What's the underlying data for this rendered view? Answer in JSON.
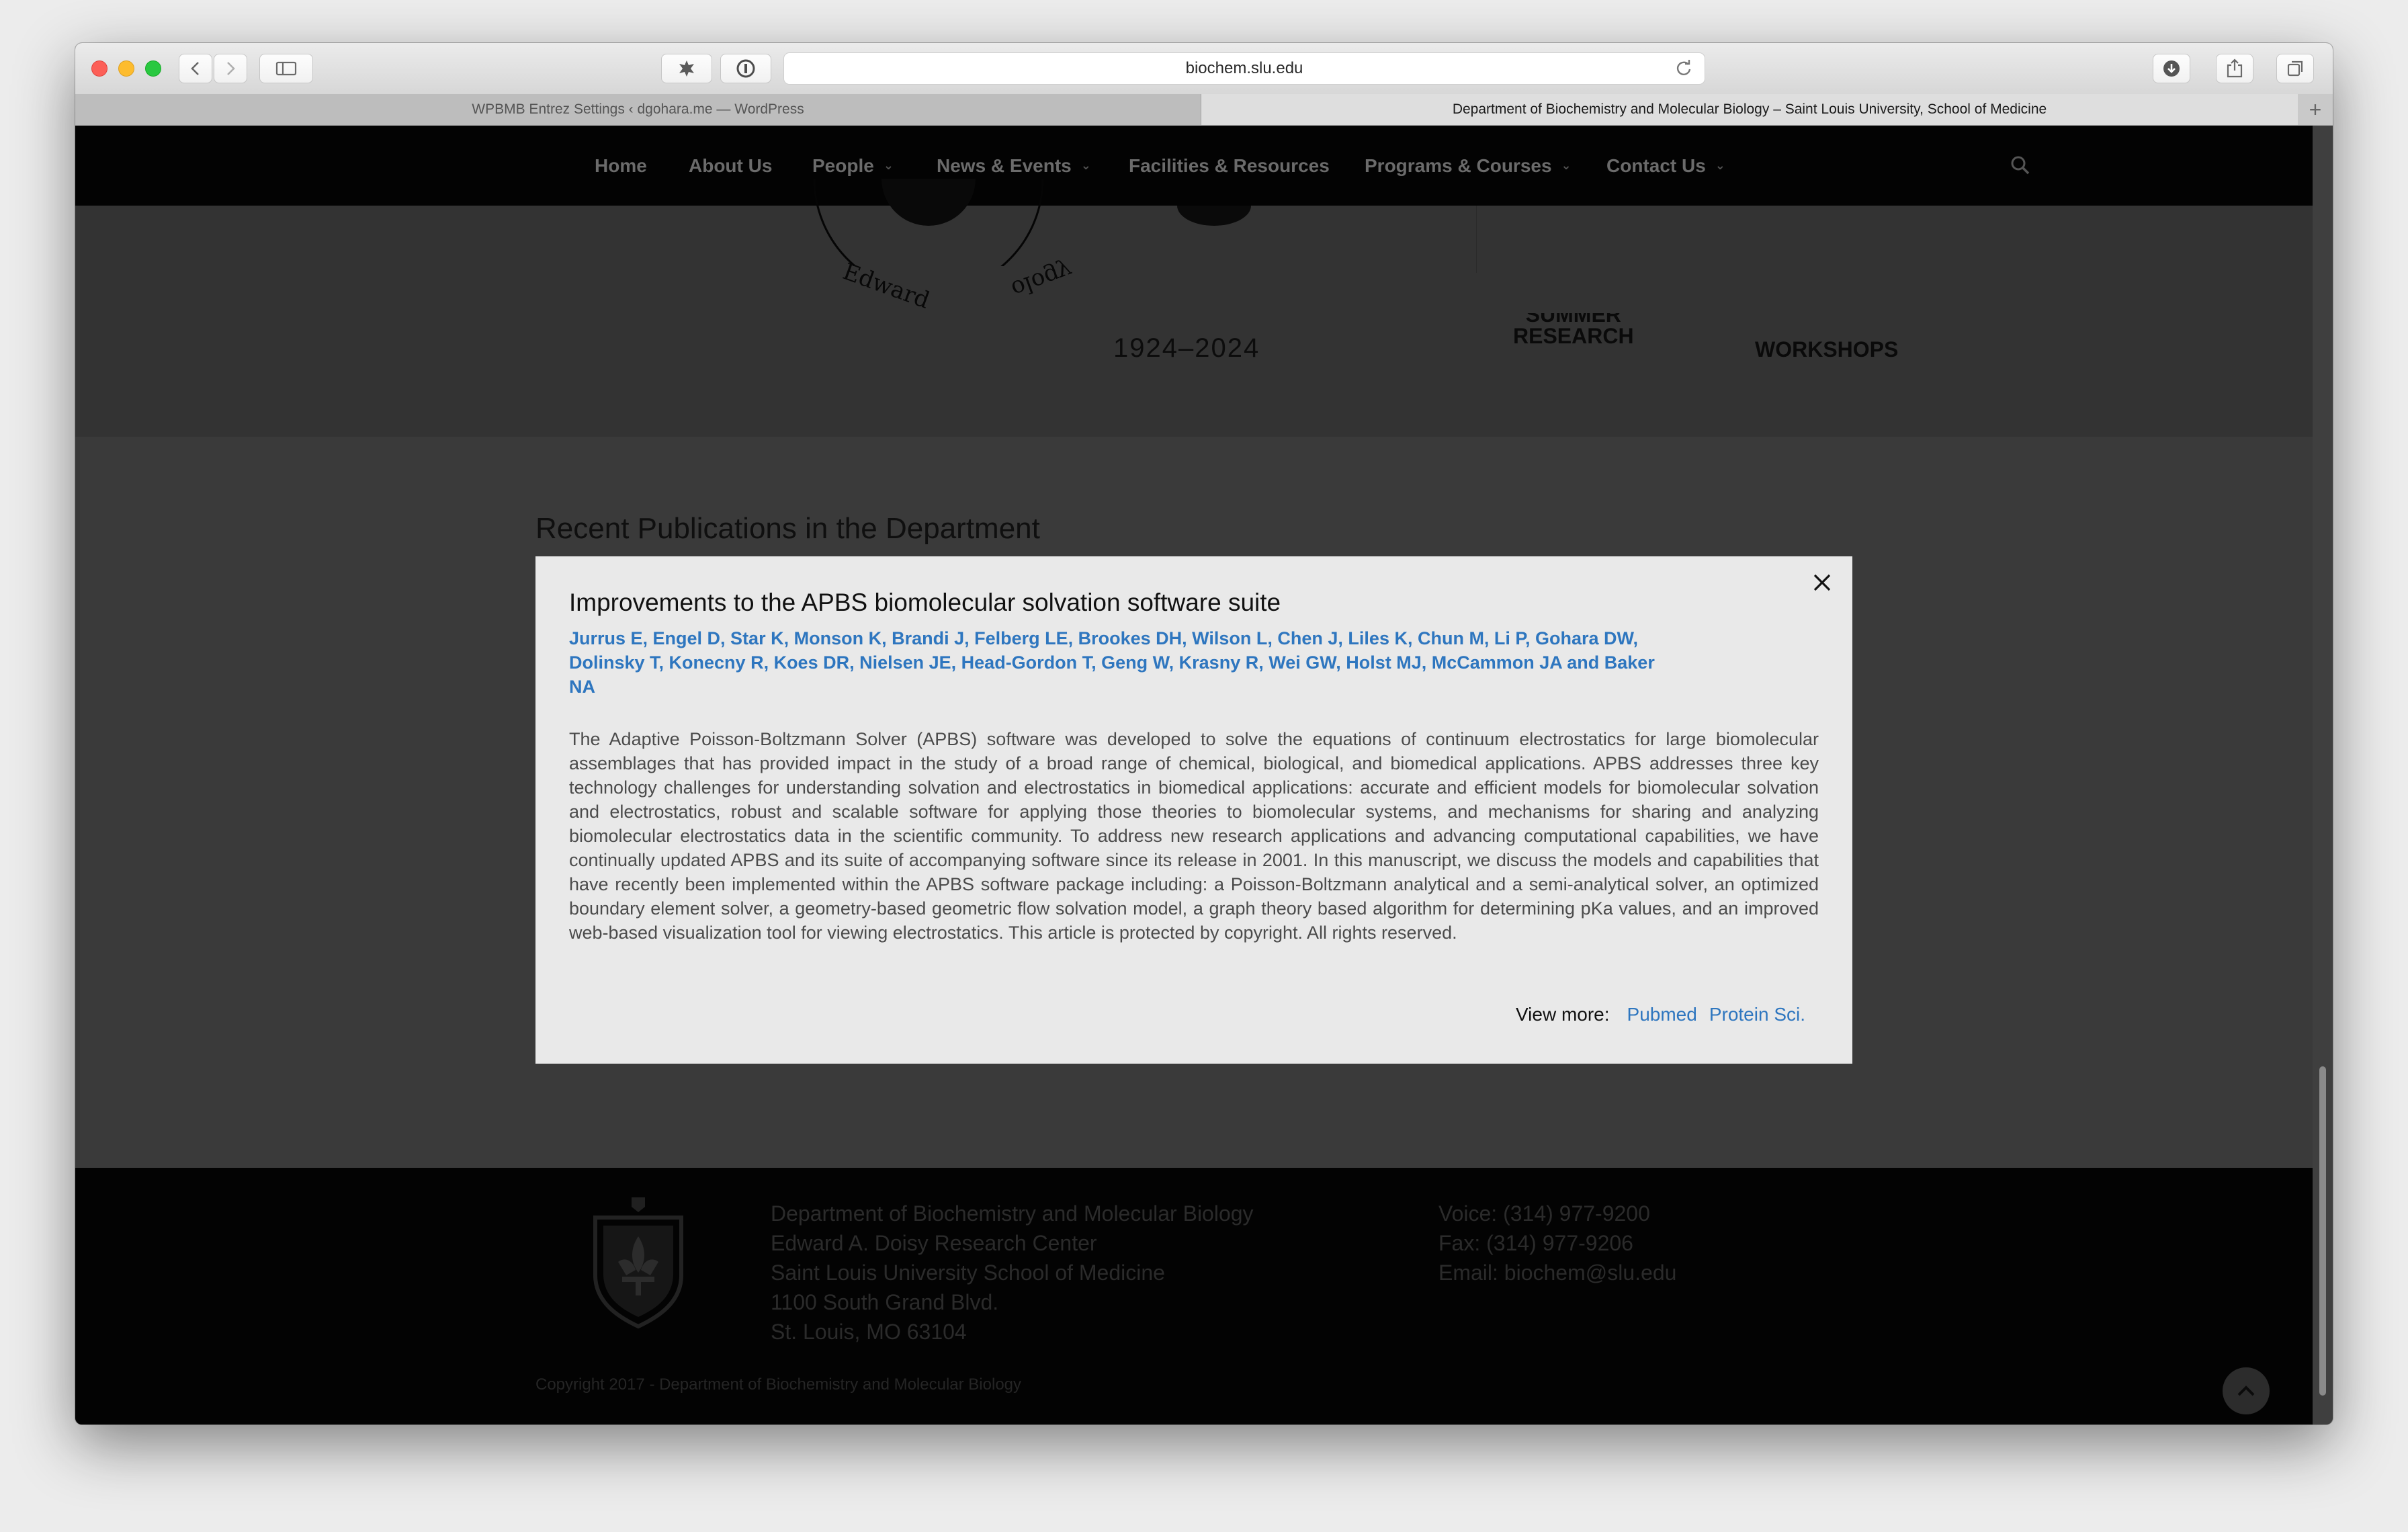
{
  "browser": {
    "url": "biochem.slu.edu",
    "tabs": [
      {
        "label": "WPBMB Entrez Settings ‹ dgohara.me — WordPress",
        "active": false
      },
      {
        "label": "Department of Biochemistry and Molecular Biology – Saint Louis University, School of Medicine",
        "active": true
      }
    ]
  },
  "nav": {
    "items": [
      {
        "label": "Home",
        "dropdown": false
      },
      {
        "label": "About Us",
        "dropdown": false
      },
      {
        "label": "People",
        "dropdown": true
      },
      {
        "label": "News & Events",
        "dropdown": true
      },
      {
        "label": "Facilities & Resources",
        "dropdown": false
      },
      {
        "label": "Programs & Courses",
        "dropdown": true
      },
      {
        "label": "Contact Us",
        "dropdown": true
      }
    ]
  },
  "banner": {
    "seal_left": "Edward",
    "seal_right": "ology",
    "years": "1924–2024",
    "link1_line1": "SUMMER",
    "link1_line2": "RESEARCH",
    "link2": "WORKSHOPS"
  },
  "section": {
    "title": "Recent Publications in the Department"
  },
  "modal": {
    "title": "Improvements to the APBS biomolecular solvation software suite",
    "authors": "Jurrus E, Engel D, Star K, Monson K, Brandi J, Felberg LE, Brookes DH, Wilson L, Chen J, Liles K, Chun M, Li P, Gohara DW, Dolinsky T, Konecny R, Koes DR, Nielsen JE, Head-Gordon T, Geng W, Krasny R, Wei GW, Holst MJ, McCammon JA and Baker NA",
    "abstract": "The Adaptive Poisson-Boltzmann Solver (APBS) software was developed to solve the equations of continuum electrostatics for large biomolecular assemblages that has provided impact in the study of a broad range of chemical, biological, and biomedical applications. APBS addresses three key technology challenges for understanding solvation and electrostatics in biomedical applications: accurate and efficient models for biomolecular solvation and electrostatics, robust and scalable software for applying those theories to biomolecular systems, and mechanisms for sharing and analyzing biomolecular electrostatics data in the scientific community. To address new research applications and advancing computational capabilities, we have continually updated APBS and its suite of accompanying software since its release in 2001. In this manuscript, we discuss the models and capabilities that have recently been implemented within the APBS software package including: a Poisson-Boltzmann analytical and a semi-analytical solver, an optimized boundary element solver, a geometry-based geometric flow solvation model, a graph theory based algorithm for determining pKa values, and an improved web-based visualization tool for viewing electrostatics. This article is protected by copyright. All rights reserved.",
    "view_more_label": "View more:",
    "link_pubmed": "Pubmed",
    "link_journal": "Protein Sci."
  },
  "footer": {
    "address": [
      "Department of Biochemistry and Molecular Biology",
      "Edward A. Doisy Research Center",
      "Saint Louis University School of Medicine",
      "1100 South Grand Blvd.",
      "St. Louis, MO 63104"
    ],
    "voice": "Voice: (314) 977-9200",
    "fax": "Fax: (314) 977-9206",
    "email": "Email: biochem@slu.edu",
    "copyright": "Copyright 2017 - Department of Biochemistry and Molecular Biology"
  },
  "colors": {
    "accent_link": "#2e76bf",
    "navbar_bg": "#030303",
    "overlay_bg": "#3a3a3a",
    "modal_bg": "#e9e9e9"
  },
  "icons": [
    "close-icon",
    "search-icon",
    "chevron-down-icon",
    "back-icon",
    "forward-icon",
    "sidebar-icon",
    "extension-icon",
    "password-icon",
    "reload-icon",
    "download-icon",
    "share-icon",
    "tabs-overview-icon",
    "add-tab-icon",
    "scroll-to-top-icon",
    "slu-shield-logo"
  ]
}
